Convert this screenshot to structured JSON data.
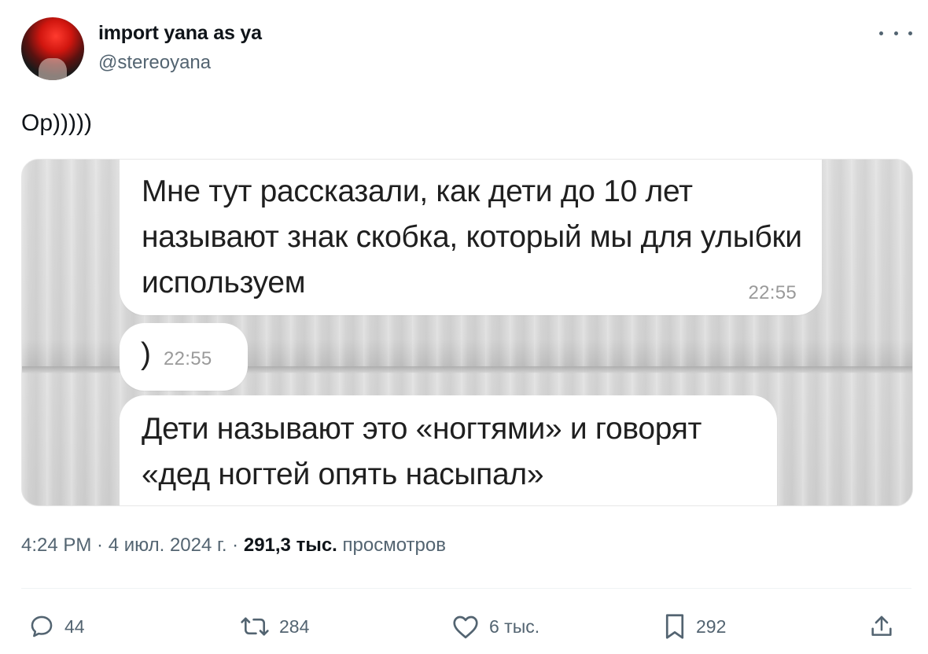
{
  "author": {
    "display_name": "import yana as ya",
    "handle": "@stereoyana"
  },
  "tweet": {
    "text": "Op)))))"
  },
  "media": {
    "messages": [
      {
        "text": "Мне тут рассказали, как дети до 10 лет называют знак скобка, который мы для улыбки используем",
        "time": "22:55"
      },
      {
        "text": ")",
        "time": "22:55"
      },
      {
        "text": "Дети называют это «ногтями» и говорят «дед ногтей опять насыпал»"
      }
    ]
  },
  "meta": {
    "time": "4:24 PM",
    "sep1": " · ",
    "date": "4 июл. 2024 г.",
    "sep2": " · ",
    "views_count": "291,3 тыс.",
    "views_label": " просмотров"
  },
  "actions": {
    "replies": "44",
    "reposts": "284",
    "likes": "6 тыс.",
    "bookmarks": "292"
  },
  "icons": {
    "more": "more-horizontal-icon",
    "reply": "reply-icon",
    "repost": "repost-icon",
    "like": "heart-icon",
    "bookmark": "bookmark-icon",
    "share": "share-icon"
  },
  "colors": {
    "text_primary": "#0f1419",
    "text_secondary": "#536471",
    "bubble_bg": "#ffffff",
    "bubble_time": "#9a9a9a",
    "avatar_accent": "#e11d12"
  }
}
